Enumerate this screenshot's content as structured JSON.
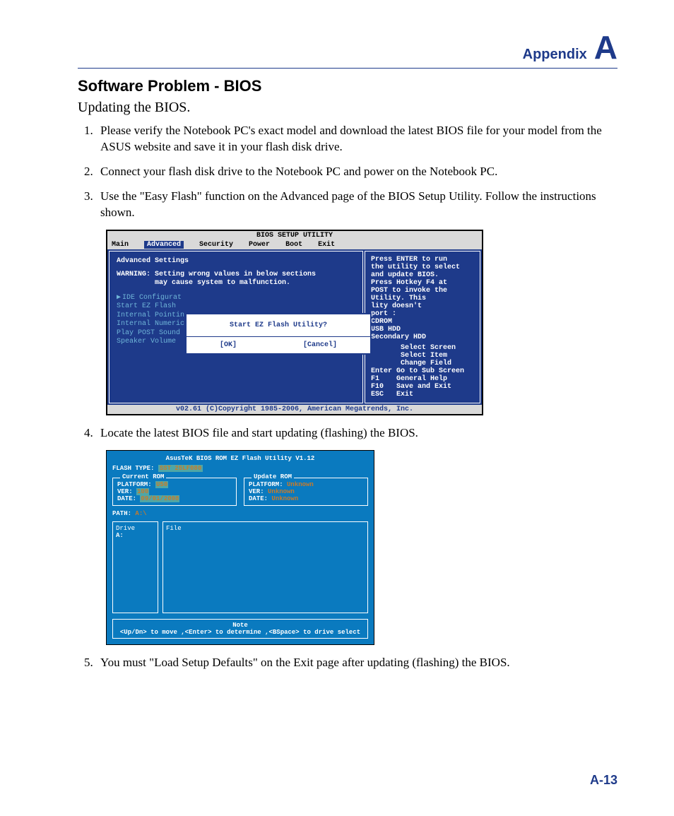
{
  "header": {
    "label": "Appendix",
    "letter": "A"
  },
  "h2": "Software Problem - BIOS",
  "h3": "Updating the BIOS.",
  "steps": [
    "Please verify the Notebook PC's exact model and download the latest BIOS file for your model from the ASUS website and save it in your flash disk drive.",
    "Connect your flash disk drive to the Notebook PC and power on the Notebook PC.",
    "Use the \"Easy Flash\" function on the Advanced page of the BIOS Setup Utility. Follow the instructions shown.",
    "Locate the latest BIOS file and start updating (flashing) the BIOS.",
    "You must \"Load Setup Defaults\" on the Exit page after updating (flashing) the BIOS."
  ],
  "bios": {
    "title": "BIOS SETUP UTILITY",
    "menu": [
      "Main",
      "Advanced",
      "Security",
      "Power",
      "Boot",
      "Exit"
    ],
    "menu_selected": "Advanced",
    "left_heading": "Advanced Settings",
    "warning": "WARNING: Setting wrong values in below sections\n         may cause system to malfunction.",
    "items": [
      "IDE Configurat",
      "Start EZ Flash",
      "Internal Pointin",
      "Internal Numeric",
      "Play POST Sound",
      "Speaker Volume"
    ],
    "right_help": "Press ENTER to run\nthe utility to select\nand update BIOS.\nPress Hotkey F4 at\nPOST to invoke the\nUtility. This\nlity doesn't\nport :\nCDROM\nUSB HDD\nSecondary HDD",
    "right_keys": "       Select Screen\n       Select Item\n       Change Field\nEnter Go to Sub Screen\nF1    General Help\nF10   Save and Exit\nESC   Exit",
    "dialog": {
      "title": "Start EZ Flash Utility?",
      "ok": "[OK]",
      "cancel": "[Cancel]"
    },
    "footer": "v02.61 (C)Copyright 1985-2006, American Megatrends, Inc."
  },
  "ez": {
    "title": "AsusTeK BIOS ROM EZ Flash Utility V1.12",
    "flash_type_label": "FLASH TYPE:",
    "flash_type_val": "SST 25LF080",
    "current": {
      "title": "Current ROM",
      "platform_l": "PLATFORM:",
      "platform": "U50",
      "ver_l": "VER:",
      "ver": "100",
      "date_l": "DATE:",
      "date": "09/01/2008"
    },
    "update": {
      "title": "Update ROM",
      "platform_l": "PLATFORM:",
      "platform": "Unknown",
      "ver_l": "VER:",
      "ver": "Unknown",
      "date_l": "DATE:",
      "date": "Unknown"
    },
    "path_l": "PATH:",
    "path": "A:\\",
    "drive_label": "Drive",
    "drive_item": "A:",
    "file_label": "File",
    "note_label": "Note",
    "note_text": "<Up/Dn> to move ,<Enter> to determine ,<BSpace> to drive select"
  },
  "pagenum": "A-13"
}
